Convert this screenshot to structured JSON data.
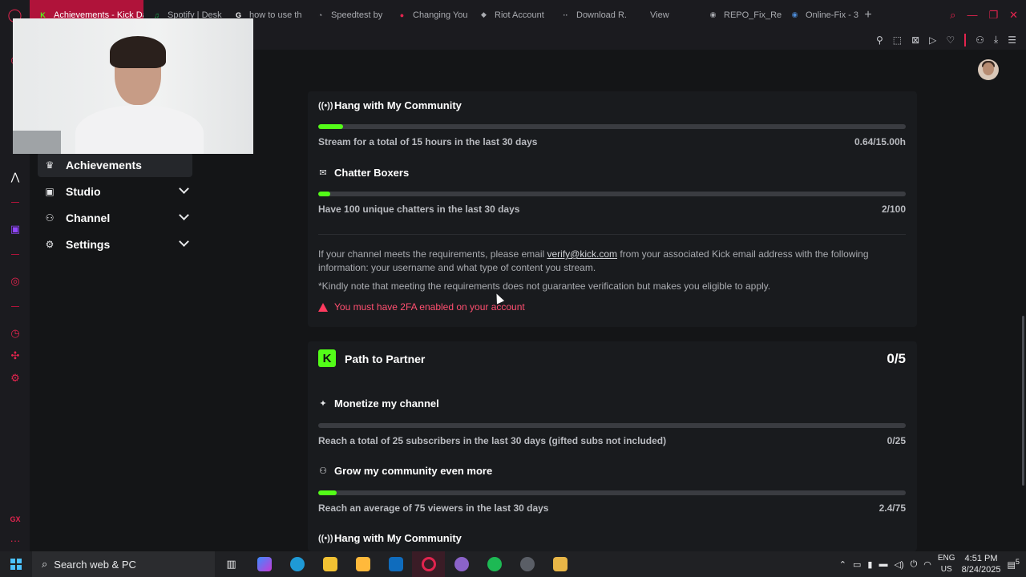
{
  "browser": {
    "tabs": [
      {
        "label": "Achievements - Kick Da",
        "active": true,
        "fav": "K",
        "fav_color": "#53fc18"
      },
      {
        "label": "Spotify | Desk",
        "fav": "♫",
        "fav_color": "#1db954"
      },
      {
        "label": "how to use th",
        "fav": "G",
        "fav_color": "#ffffff"
      },
      {
        "label": "Speedtest by",
        "fav": "◔",
        "fav_color": "#c9cbd0"
      },
      {
        "label": "Changing You",
        "fav": "●",
        "fav_color": "#e3244e"
      },
      {
        "label": "Riot Account",
        "fav": "◆",
        "fav_color": "#c9cbd0"
      },
      {
        "label": "Download R.",
        "fav": "··",
        "fav_color": "#c9cbd0"
      },
      {
        "label": "View",
        "fav": "",
        "fav_color": "#c9cbd0"
      },
      {
        "label": "REPO_Fix_Re",
        "fav": "◉",
        "fav_color": "#c9cbd0"
      },
      {
        "label": "Online-Fix - 3",
        "fav": "◉",
        "fav_color": "#4c8bd6"
      }
    ],
    "new_tab": "+"
  },
  "sidebar": {
    "items": [
      {
        "label": "Achievements",
        "icon": "trophy-icon",
        "active": true
      },
      {
        "label": "Studio",
        "icon": "studio-icon"
      },
      {
        "label": "Channel",
        "icon": "channel-icon"
      },
      {
        "label": "Settings",
        "icon": "gear-icon"
      }
    ]
  },
  "verified": {
    "achievements": [
      {
        "title": "Hang with My Community",
        "icon": "broadcast-icon",
        "desc": "Stream for a total of 15 hours in the last 30 days",
        "value": "0.64/15.00h",
        "progress": 0.0427
      },
      {
        "title": "Chatter Boxers",
        "icon": "chat-icon",
        "desc": "Have 100 unique chatters in the last 30 days",
        "value": "2/100",
        "progress": 0.02
      }
    ],
    "info_prefix": "If your channel meets the requirements, please email ",
    "info_email": "verify@kick.com",
    "info_suffix": " from your associated Kick email address with the following information: your username and what type of content you stream.",
    "note": "*Kindly note that meeting the requirements does not guarantee verification but makes you eligible to apply.",
    "warning": "You must have 2FA enabled on your account"
  },
  "partner": {
    "logo": "K",
    "title": "Path to Partner",
    "count": "0/5",
    "achievements": [
      {
        "title": "Monetize my channel",
        "icon": "sparkle-icon",
        "desc": "Reach a total of 25 subscribers in the last 30 days (gifted subs not included)",
        "value": "0/25",
        "progress": 0
      },
      {
        "title": "Grow my community even more",
        "icon": "community-icon",
        "desc": "Reach an average of 75 viewers in the last 30 days",
        "value": "2.4/75",
        "progress": 0.032
      },
      {
        "title": "Hang with My Community",
        "icon": "broadcast-icon"
      }
    ]
  },
  "taskbar": {
    "search_placeholder": "Search web & PC",
    "lang_top": "ENG",
    "lang_bottom": "US",
    "time": "4:51 PM",
    "date": "8/24/2025",
    "notif_count": "5"
  },
  "colors": {
    "accent": "#53fc18",
    "opera": "#e3244e",
    "warning": "#ff4f70"
  }
}
